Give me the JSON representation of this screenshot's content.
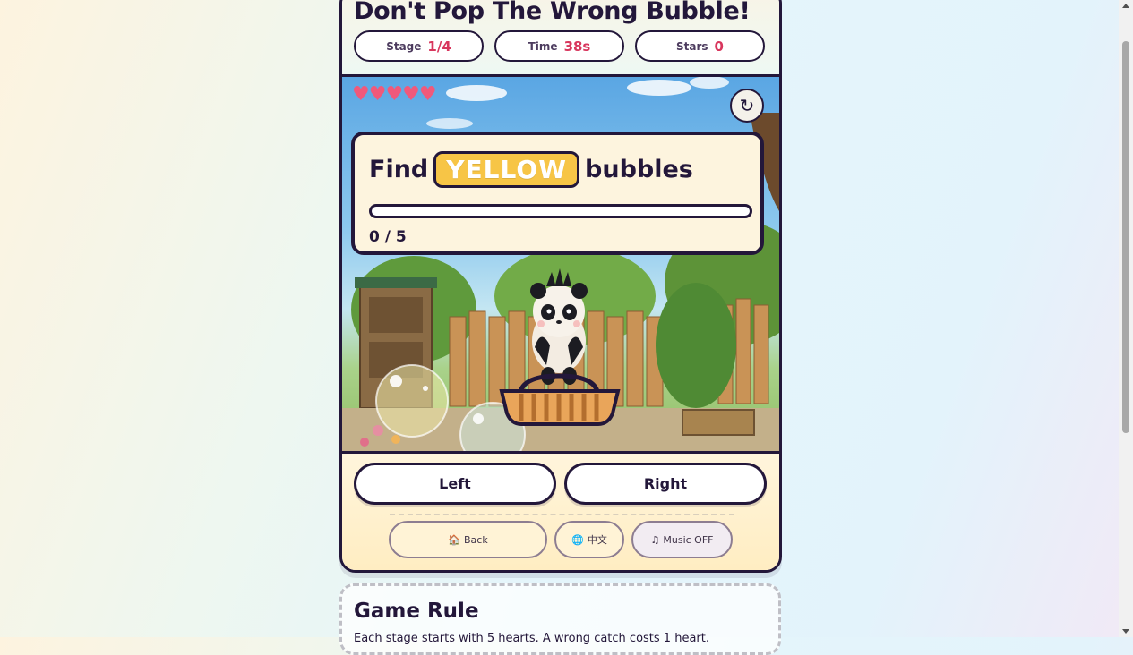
{
  "header": {
    "title": "Don't Pop The Wrong Bubble!",
    "stage_label": "Stage",
    "stage_value": "1/4",
    "time_label": "Time",
    "time_value": "38s",
    "stars_label": "Stars",
    "stars_value": "0"
  },
  "game": {
    "hearts": "♥♥♥♥♥",
    "lives": 5,
    "refresh_icon": "↻",
    "task_prefix": "Find",
    "target_color": "YELLOW",
    "task_suffix": "bubbles",
    "progress_text": "0 / 5",
    "progress_fraction": 0,
    "colors": {
      "target": "#f7c546",
      "accent": "#d8365d",
      "outline": "#23173a",
      "heart": "#f0597b"
    }
  },
  "controls": {
    "left_label": "Left",
    "right_label": "Right",
    "back_icon": "🏠",
    "back_label": "Back",
    "lang_icon": "🌐",
    "lang_label": "中文",
    "music_icon": "♫",
    "music_label": "Music OFF"
  },
  "rule": {
    "title": "Game Rule",
    "text": "Each stage starts with 5 hearts. A wrong catch costs 1 heart."
  }
}
